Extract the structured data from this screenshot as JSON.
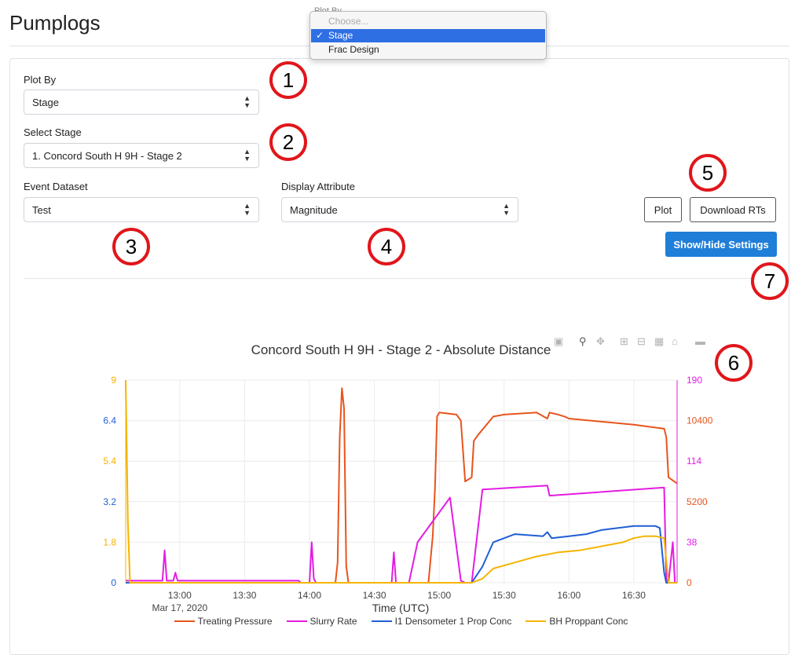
{
  "page": {
    "title": "Pumplogs"
  },
  "dropdown_menu": {
    "ghost_label": "Plot By",
    "options": [
      {
        "label": "Choose...",
        "disabled": true
      },
      {
        "label": "Stage",
        "selected": true
      },
      {
        "label": "Frac Design"
      }
    ]
  },
  "form": {
    "plot_by": {
      "label": "Plot By",
      "value": "Stage"
    },
    "select_stage": {
      "label": "Select Stage",
      "value": "1. Concord South H 9H - Stage 2"
    },
    "event_dataset": {
      "label": "Event Dataset",
      "value": "Test"
    },
    "display_attribute": {
      "label": "Display Attribute",
      "value": "Magnitude"
    }
  },
  "buttons": {
    "plot": "Plot",
    "download": "Download RTs",
    "settings": "Show/Hide Settings"
  },
  "callouts": [
    "1",
    "2",
    "3",
    "4",
    "5",
    "6",
    "7"
  ],
  "modebar_icons": [
    "camera-icon",
    "zoom-icon",
    "pan-icon",
    "zoom-in-icon",
    "zoom-out-icon",
    "autoscale-icon",
    "home-icon",
    "spike-lines-icon"
  ],
  "chart_data": {
    "type": "line",
    "title": "Concord South H 9H - Stage 2 - Absolute Distance",
    "xlabel": "Time (UTC)",
    "x_tick_labels": [
      "13:00",
      "13:30",
      "14:00",
      "14:30",
      "15:00",
      "15:30",
      "16:00",
      "16:30"
    ],
    "x_date_label": "Mar 17, 2020",
    "x_range_minutes": [
      755,
      1010
    ],
    "y_axes": [
      {
        "side": "left",
        "ticks": [
          "0",
          "1.8",
          "3.2",
          "5.4",
          "6.4",
          "9"
        ],
        "tick_colors": [
          "#1f5fd6",
          "#f5b400",
          "#1f5fd6",
          "#f5b400",
          "#1f5fd6",
          "#f5b400"
        ]
      },
      {
        "side": "right",
        "ticks": [
          "0",
          "38",
          "5200",
          "114",
          "10400",
          "190"
        ],
        "tick_colors": [
          "#e8541c",
          "#e31ce3",
          "#e8541c",
          "#e31ce3",
          "#e8541c",
          "#e31ce3"
        ]
      }
    ],
    "y_range_fraction": [
      0,
      1
    ],
    "series": [
      {
        "name": "Treating Pressure",
        "color": "#e8541c",
        "x": [
          755,
          852,
          853,
          854,
          855,
          856,
          857,
          858,
          880,
          895,
          897,
          898,
          899,
          900,
          908,
          910,
          912,
          915,
          916,
          918,
          925,
          930,
          945,
          950,
          951,
          955,
          958,
          960,
          990,
          1004,
          1005,
          1006,
          1010
        ],
        "y": [
          0,
          0,
          0.1,
          0.72,
          0.96,
          0.86,
          0.08,
          0,
          0,
          0,
          0.23,
          0.46,
          0.82,
          0.84,
          0.83,
          0.8,
          0.5,
          0.52,
          0.7,
          0.73,
          0.82,
          0.83,
          0.84,
          0.81,
          0.84,
          0.83,
          0.82,
          0.81,
          0.78,
          0.76,
          0.72,
          0.52,
          0.49
        ]
      },
      {
        "name": "Slurry Rate",
        "color": "#e31ce3",
        "x": [
          755,
          772,
          773,
          774,
          775,
          777,
          778,
          779,
          835,
          836,
          840,
          841,
          842,
          843,
          855,
          878,
          879,
          880,
          886,
          890,
          905,
          910,
          912,
          915,
          920,
          950,
          951,
          1004,
          1005,
          1006,
          1008,
          1009,
          1010
        ],
        "y": [
          0.01,
          0.01,
          0.16,
          0.01,
          0.01,
          0.01,
          0.05,
          0.01,
          0.01,
          0,
          0,
          0.2,
          0.02,
          0,
          0,
          0,
          0.15,
          0,
          0,
          0.2,
          0.42,
          0.01,
          0,
          0,
          0.46,
          0.48,
          0.43,
          0.47,
          0.02,
          0,
          0.2,
          0,
          0
        ]
      },
      {
        "name": "I1 Densometer 1 Prop Conc",
        "color": "#1f5fd6",
        "x": [
          755,
          912,
          915,
          920,
          925,
          935,
          948,
          950,
          952,
          960,
          968,
          975,
          990,
          995,
          1000,
          1002,
          1004,
          1005,
          1010
        ],
        "y": [
          0,
          0,
          0,
          0.08,
          0.2,
          0.24,
          0.23,
          0.25,
          0.22,
          0.23,
          0.24,
          0.26,
          0.28,
          0.28,
          0.28,
          0.27,
          0.05,
          0,
          0
        ]
      },
      {
        "name": "BH Proppant Conc",
        "color": "#f5b400",
        "x": [
          755,
          756,
          757,
          915,
          920,
          925,
          935,
          945,
          955,
          965,
          975,
          985,
          990,
          995,
          1000,
          1004,
          1006,
          1010
        ],
        "y": [
          1.0,
          0.3,
          0,
          0,
          0.02,
          0.07,
          0.1,
          0.13,
          0.15,
          0.16,
          0.18,
          0.2,
          0.22,
          0.23,
          0.23,
          0.22,
          0,
          0
        ]
      }
    ],
    "legend_position": "bottom",
    "grid": true
  }
}
